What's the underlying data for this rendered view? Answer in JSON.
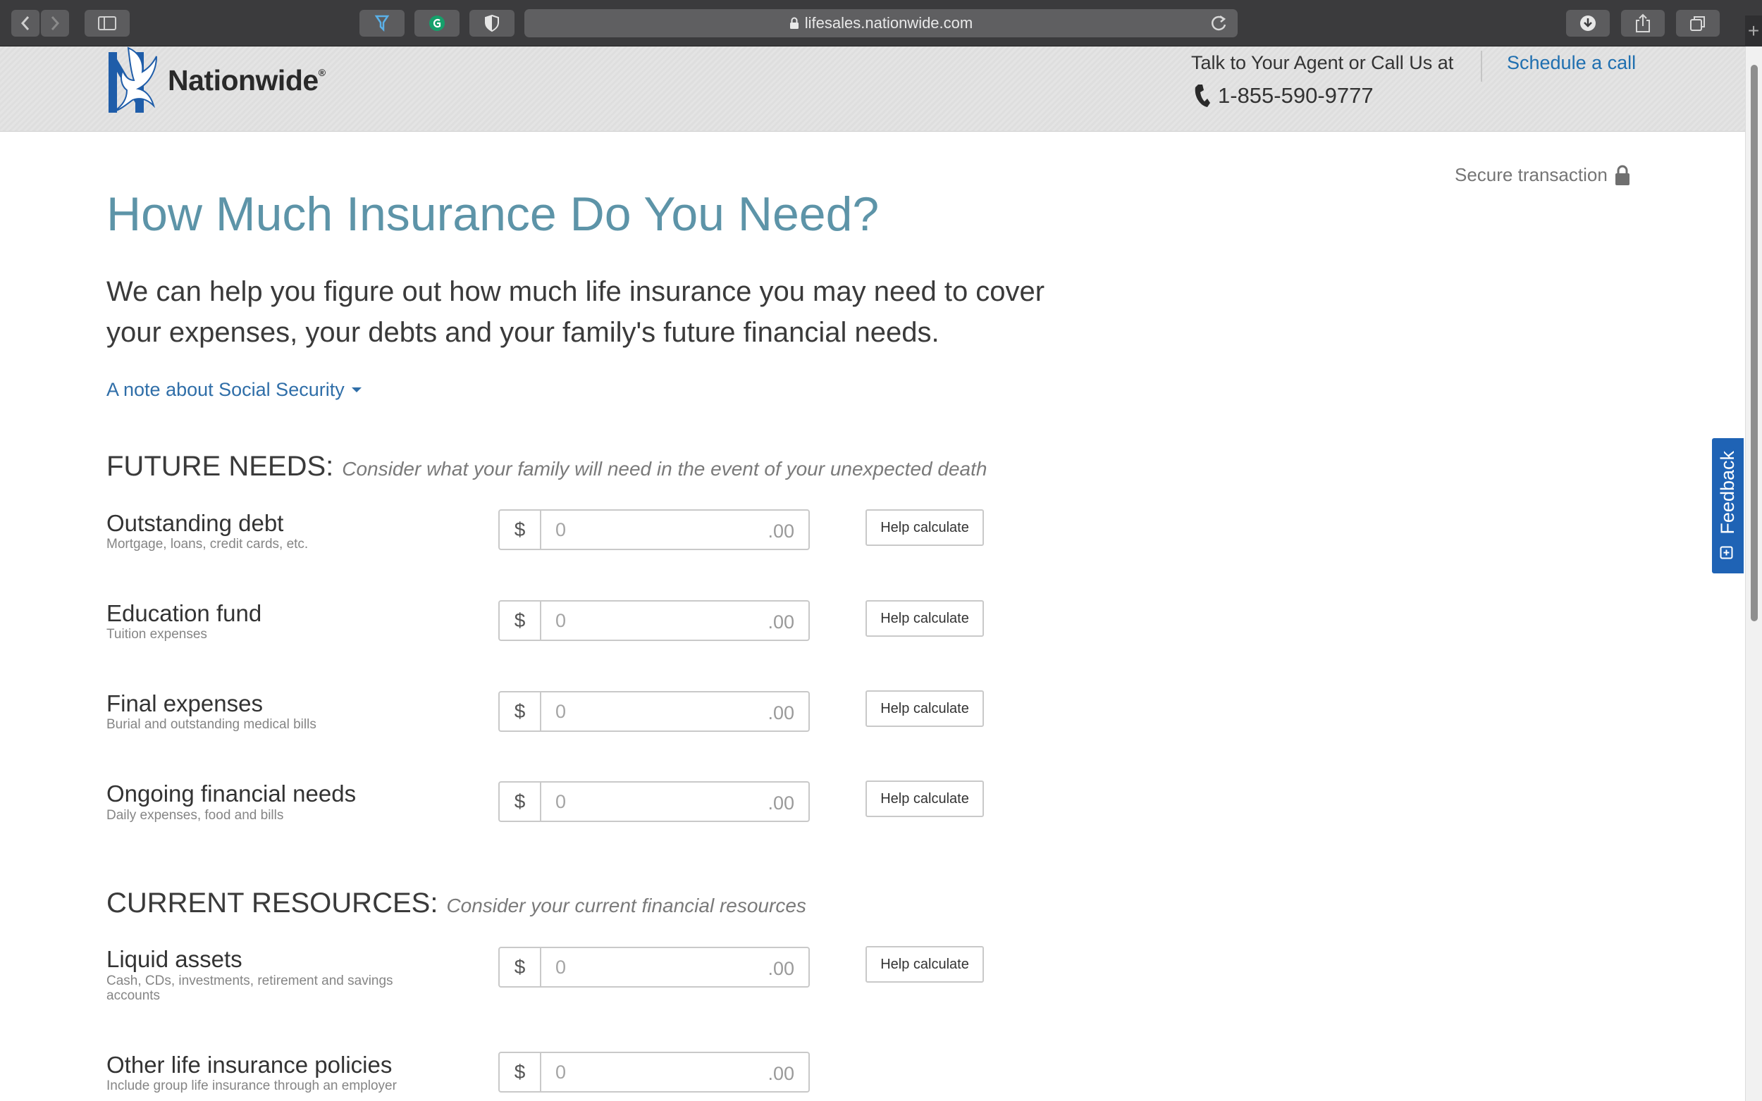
{
  "browser": {
    "url": "lifesales.nationwide.com",
    "icons": [
      "back-icon",
      "forward-icon",
      "sidebar-icon",
      "pin-icon",
      "grammarly-icon",
      "shield-icon",
      "lock-icon",
      "reload-icon",
      "download-icon",
      "share-icon",
      "tabs-icon",
      "new-tab-icon"
    ]
  },
  "header": {
    "logo_text": "Nationwide",
    "logo_mark": "®",
    "agent_text": "Talk to Your Agent or Call Us at",
    "phone": "1-855-590-9777",
    "schedule_label": "Schedule a call"
  },
  "main": {
    "secure_label": "Secure transaction",
    "title": "How Much Insurance Do You Need?",
    "intro": "We can help you figure out how much life insurance you may need to cover your expenses, your debts and your family's future financial needs.",
    "note_link": "A note about Social Security"
  },
  "sections": {
    "future": {
      "heading": "FUTURE NEEDS:",
      "subheading": "Consider what your family will need in the event of your unexpected death",
      "rows": [
        {
          "label": "Outstanding debt",
          "desc": "Mortgage, loans, credit cards, etc.",
          "currency": "$",
          "placeholder": "0",
          "cents": ".00",
          "help": "Help calculate"
        },
        {
          "label": "Education fund",
          "desc": "Tuition expenses",
          "currency": "$",
          "placeholder": "0",
          "cents": ".00",
          "help": "Help calculate"
        },
        {
          "label": "Final expenses",
          "desc": "Burial and outstanding medical bills",
          "currency": "$",
          "placeholder": "0",
          "cents": ".00",
          "help": "Help calculate"
        },
        {
          "label": "Ongoing financial needs",
          "desc": "Daily expenses, food and bills",
          "currency": "$",
          "placeholder": "0",
          "cents": ".00",
          "help": "Help calculate"
        }
      ]
    },
    "current": {
      "heading": "CURRENT RESOURCES:",
      "subheading": "Consider your current financial resources",
      "rows": [
        {
          "label": "Liquid assets",
          "desc": "Cash, CDs, investments, retirement and savings accounts",
          "currency": "$",
          "placeholder": "0",
          "cents": ".00",
          "help": "Help calculate"
        },
        {
          "label": "Other life insurance policies",
          "desc": "Include group life insurance through an employer",
          "currency": "$",
          "placeholder": "0",
          "cents": ".00"
        }
      ]
    }
  },
  "feedback_label": "Feedback",
  "colors": {
    "title": "#5d94a8",
    "link": "#1f6fb0",
    "feedback": "#1f63b5"
  }
}
